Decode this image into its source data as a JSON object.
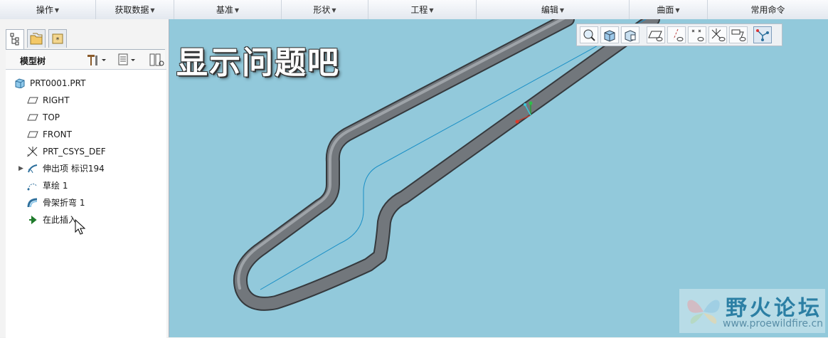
{
  "ribbon": {
    "items": [
      {
        "label": "操作"
      },
      {
        "label": "获取数据"
      },
      {
        "label": "基准"
      },
      {
        "label": "形状"
      },
      {
        "label": "工程"
      },
      {
        "label": "编辑"
      },
      {
        "label": "曲面"
      },
      {
        "label": "常用命令"
      }
    ]
  },
  "model_tree": {
    "title": "模型树",
    "nodes": [
      {
        "label": "PRT0001.PRT",
        "icon": "part-icon"
      },
      {
        "label": "RIGHT",
        "icon": "datum-plane-icon"
      },
      {
        "label": "TOP",
        "icon": "datum-plane-icon"
      },
      {
        "label": "FRONT",
        "icon": "datum-plane-icon"
      },
      {
        "label": "PRT_CSYS_DEF",
        "icon": "csys-icon"
      },
      {
        "label": "伸出项 标识194",
        "icon": "protrusion-icon"
      },
      {
        "label": "草绘 1",
        "icon": "sketch-icon"
      },
      {
        "label": "骨架折弯 1",
        "icon": "spinal-bend-icon"
      },
      {
        "label": "在此插入",
        "icon": "insert-here-icon"
      }
    ]
  },
  "overlay": {
    "title": "显示问题吧"
  },
  "watermark": {
    "text": "野火论坛",
    "url": "www.proewildfire.cn"
  },
  "colors": {
    "viewport_bg": "#92c9db",
    "pipe": "#6e7378",
    "sketch_line": "#1a8fc6"
  }
}
